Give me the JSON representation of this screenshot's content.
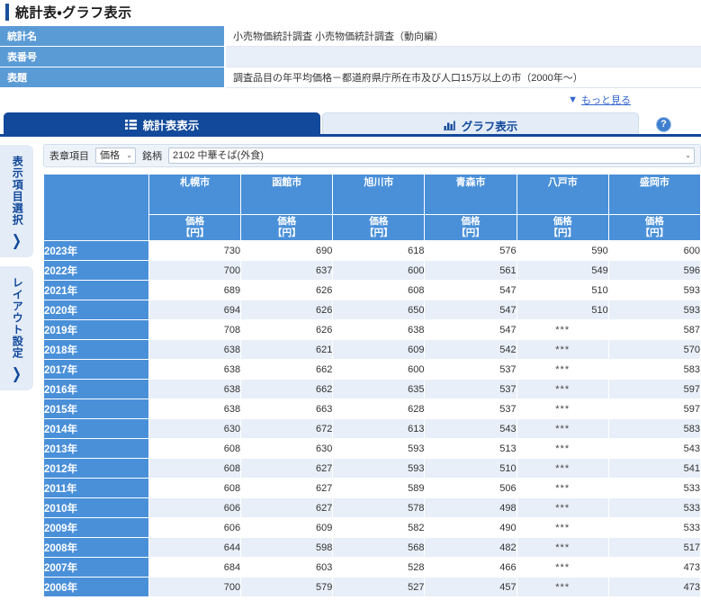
{
  "page": {
    "title": "統計表・グラフ表示"
  },
  "meta": {
    "rows": [
      {
        "label": "統計名",
        "value": "小売物価統計調査 小売物価統計調査（動向編）"
      },
      {
        "label": "表番号",
        "value": ""
      },
      {
        "label": "表題",
        "value": "調査品目の年平均価格－都道府県庁所在市及び人口15万以上の市（2000年～）"
      }
    ]
  },
  "more": {
    "caret": "▼",
    "label": "もっと見る"
  },
  "tabs": {
    "table_tab": {
      "label": "統計表表示",
      "icon": "list-icon",
      "active": true
    },
    "graph_tab": {
      "label": "グラフ表示",
      "icon": "bar-chart-icon",
      "active": false
    },
    "help": {
      "label": "?",
      "icon": "help-icon"
    }
  },
  "sidebar": {
    "items": [
      {
        "label": "表示項目選択",
        "chevron": "❯"
      },
      {
        "label": "レイアウト設定",
        "chevron": "❯"
      }
    ]
  },
  "toolbar": {
    "hyosho_label": "表章項目",
    "hyosho_value": "価格",
    "hyosho_options": [
      "価格"
    ],
    "meigara_label": "銘柄",
    "meigara_value": "2102 中華そば(外食)",
    "meigara_options": [
      "2102 中華そば(外食)"
    ],
    "caret": "⌄"
  },
  "chart_data": {
    "type": "table",
    "title": "調査品目の年平均価格－都道府県庁所在市及び人口15万以上の市（2000年～）",
    "row_header_label": "",
    "unit_label": "価格",
    "unit_suffix": "【円】",
    "missing_marker": "***",
    "categories": [
      "札幌市",
      "函館市",
      "旭川市",
      "青森市",
      "八戸市",
      "盛岡市"
    ],
    "x": [
      "2023年",
      "2022年",
      "2021年",
      "2020年",
      "2019年",
      "2018年",
      "2017年",
      "2016年",
      "2015年",
      "2014年",
      "2013年",
      "2012年",
      "2011年",
      "2010年",
      "2009年",
      "2008年",
      "2007年",
      "2006年"
    ],
    "xlabel": "年",
    "ylabel": "価格【円】",
    "series": [
      {
        "name": "札幌市",
        "values": [
          730,
          700,
          689,
          694,
          708,
          638,
          638,
          638,
          638,
          630,
          608,
          608,
          608,
          606,
          606,
          644,
          684,
          700
        ]
      },
      {
        "name": "函館市",
        "values": [
          690,
          637,
          626,
          626,
          626,
          621,
          662,
          662,
          663,
          672,
          630,
          627,
          627,
          627,
          609,
          598,
          603,
          579
        ]
      },
      {
        "name": "旭川市",
        "values": [
          618,
          600,
          608,
          650,
          638,
          609,
          600,
          635,
          628,
          613,
          593,
          593,
          589,
          578,
          582,
          568,
          528,
          527
        ]
      },
      {
        "name": "青森市",
        "values": [
          576,
          561,
          547,
          547,
          547,
          542,
          537,
          537,
          537,
          543,
          513,
          510,
          506,
          498,
          490,
          482,
          466,
          457
        ]
      },
      {
        "name": "八戸市",
        "values": [
          590,
          549,
          510,
          510,
          "***",
          "***",
          "***",
          "***",
          "***",
          "***",
          "***",
          "***",
          "***",
          "***",
          "***",
          "***",
          "***",
          "***"
        ]
      },
      {
        "name": "盛岡市",
        "values": [
          600,
          596,
          593,
          593,
          587,
          570,
          583,
          597,
          597,
          583,
          543,
          541,
          533,
          533,
          533,
          517,
          473,
          473
        ]
      }
    ]
  },
  "colors": {
    "header_blue": "#4a90d9",
    "tab_active": "#12499b",
    "meta_header": "#5b9bd5",
    "row_alt": "#e8eff8",
    "link": "#3366cc"
  }
}
